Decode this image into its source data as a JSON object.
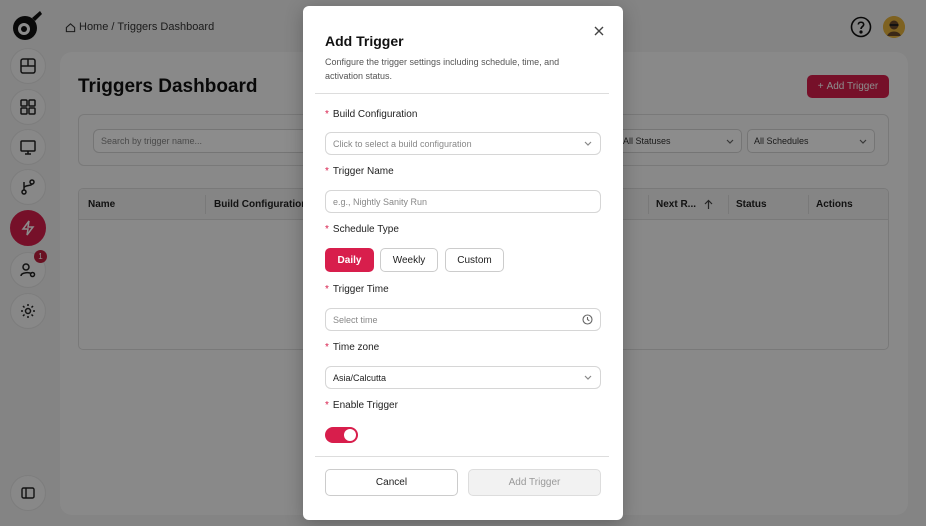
{
  "breadcrumb": {
    "home": "Home",
    "separator": "/",
    "current": "Triggers Dashboard"
  },
  "sidebar": {
    "items": [
      {
        "name": "builds",
        "icon": "layout-icon"
      },
      {
        "name": "dashboard",
        "icon": "grid-icon"
      },
      {
        "name": "devices",
        "icon": "monitor-icon"
      },
      {
        "name": "branches",
        "icon": "git-branch-icon"
      },
      {
        "name": "triggers",
        "icon": "lightning-icon",
        "active": true
      },
      {
        "name": "users",
        "icon": "user-settings-icon",
        "badge": "1"
      },
      {
        "name": "settings",
        "icon": "gear-icon"
      }
    ]
  },
  "page": {
    "title": "Triggers Dashboard",
    "add_button": "Add Trigger",
    "search_placeholder": "Search by trigger name...",
    "status_filter": "All Statuses",
    "schedule_filter": "All Schedules",
    "columns": [
      "Name",
      "Build Configuration",
      "Next R...",
      "Status",
      "Actions"
    ]
  },
  "modal": {
    "title": "Add Trigger",
    "description": "Configure the trigger settings including schedule, time, and activation status.",
    "required_mark": "*",
    "build_config": {
      "label": "Build Configuration",
      "placeholder": "Click to select a build configuration"
    },
    "trigger_name": {
      "label": "Trigger Name",
      "placeholder": "e.g., Nightly Sanity Run"
    },
    "schedule_type": {
      "label": "Schedule Type",
      "options": [
        "Daily",
        "Weekly",
        "Custom"
      ],
      "selected": "Daily"
    },
    "trigger_time": {
      "label": "Trigger Time",
      "placeholder": "Select time"
    },
    "time_zone": {
      "label": "Time zone",
      "value": "Asia/Calcutta"
    },
    "enable_trigger": {
      "label": "Enable Trigger",
      "enabled": true
    },
    "cancel_label": "Cancel",
    "submit_label": "Add Trigger"
  },
  "colors": {
    "accent": "#d81e4c"
  }
}
